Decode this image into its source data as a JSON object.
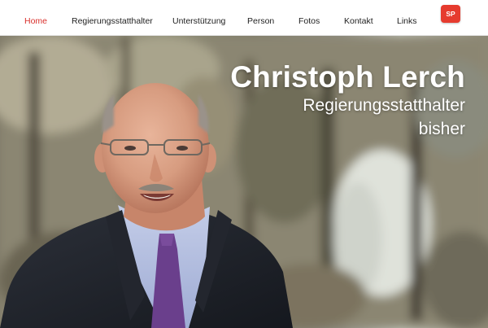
{
  "nav": {
    "items": [
      {
        "label": "Home",
        "active": true
      },
      {
        "label": "Regierungsstatthalter",
        "active": false
      },
      {
        "label": "Unterstützung",
        "active": false
      },
      {
        "label": "Person",
        "active": false
      },
      {
        "label": "Fotos",
        "active": false
      },
      {
        "label": "Kontakt",
        "active": false
      },
      {
        "label": "Links",
        "active": false
      }
    ],
    "logo_text": "SP",
    "accent_color": "#d9302c",
    "logo_color": "#e63b2e"
  },
  "hero": {
    "name": "Christoph Lerch",
    "role": "Regierungsstatthalter",
    "status": "bisher"
  }
}
